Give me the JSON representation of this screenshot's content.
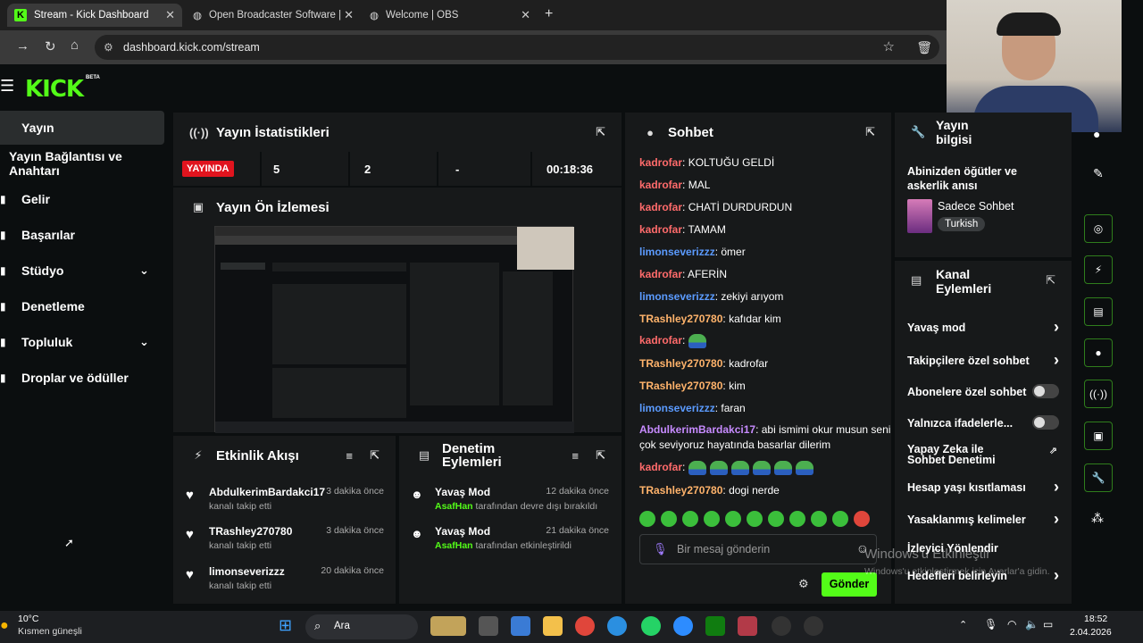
{
  "browser": {
    "tabs": [
      {
        "title": "Stream - Kick Dashboard",
        "active": true
      },
      {
        "title": "Open Broadcaster Software | OB",
        "active": false
      },
      {
        "title": "Welcome | OBS",
        "active": false
      }
    ],
    "url": "dashboard.kick.com/stream"
  },
  "logo": {
    "text": "KICK",
    "badge": "BETA"
  },
  "sidebar": {
    "items": [
      {
        "label": "Yayın",
        "active": true
      },
      {
        "label": "Yayın Bağlantısı ve Anahtarı"
      },
      {
        "label": "Gelir"
      },
      {
        "label": "Başarılar"
      },
      {
        "label": "Stüdyo",
        "expand": true
      },
      {
        "label": "Denetleme"
      },
      {
        "label": "Topluluk",
        "expand": true
      },
      {
        "label": "Droplar ve ödüller"
      }
    ]
  },
  "stats": {
    "title": "Yayın İstatistikleri",
    "live": "YAYINDA",
    "viewers": "5",
    "followers": "2",
    "subs": "-",
    "duration": "00:18:36"
  },
  "preview": {
    "title": "Yayın Ön İzlemesi"
  },
  "activity": {
    "title": "Etkinlik Akışı",
    "items": [
      {
        "user": "AbdulkerimBardakci17",
        "time": "3 dakika önce",
        "text": "kanalı takip etti"
      },
      {
        "user": "TRashley270780",
        "time": "3 dakika önce",
        "text": "kanalı takip etti"
      },
      {
        "user": "limonseverizzz",
        "time": "20 dakika önce",
        "text": "kanalı takip etti"
      }
    ]
  },
  "moderation": {
    "title": "Denetim Eylemleri",
    "items": [
      {
        "action": "Yavaş Mod",
        "time": "12 dakika önce",
        "by": "AsafHan",
        "text": "tarafından devre dışı bırakıldı"
      },
      {
        "action": "Yavaş Mod",
        "time": "21 dakika önce",
        "by": "AsafHan",
        "text": "tarafından etkinleştirildi"
      }
    ]
  },
  "chat": {
    "title": "Sohbet",
    "colors": {
      "kadrofar": "#ff6b6b",
      "limonseverizzz": "#5b9bff",
      "TRashley270780": "#ffb36b",
      "AbdulkerimBardakci17": "#c78bff"
    },
    "messages": [
      {
        "user": "kadrofar",
        "text": "KOLTUĞU GELDİ"
      },
      {
        "user": "kadrofar",
        "text": "MAL"
      },
      {
        "user": "kadrofar",
        "text": "CHATİ DURDURDUN"
      },
      {
        "user": "kadrofar",
        "text": "TAMAM"
      },
      {
        "user": "limonseverizzz",
        "text": "ömer"
      },
      {
        "user": "kadrofar",
        "text": "AFERİN"
      },
      {
        "user": "limonseverizzz",
        "text": "zekiyi arıyom"
      },
      {
        "user": "TRashley270780",
        "text": "kafıdar kim"
      },
      {
        "user": "kadrofar",
        "text": "",
        "emotes": 1
      },
      {
        "user": "TRashley270780",
        "text": "kadrofar"
      },
      {
        "user": "TRashley270780",
        "text": "kim"
      },
      {
        "user": "limonseverizzz",
        "text": "faran"
      },
      {
        "user": "AbdulkerimBardakci17",
        "text": "abi ismimi okur musun seni",
        "text2": "çok seviyoruz hayatında basarlar dilerim"
      },
      {
        "user": "kadrofar",
        "text": "",
        "emotes": 6
      },
      {
        "user": "TRashley270780",
        "text": "dogi nerde"
      }
    ],
    "placeholder": "Bir mesaj gönderin",
    "send": "Gönder"
  },
  "info": {
    "title": "Yayın bilgisi",
    "stream_title": "Abinizden öğütler ve askerlik anısı",
    "category": "Sadece Sohbet",
    "tag": "Turkish"
  },
  "channel_actions": {
    "title": "Kanal Eylemleri",
    "items": [
      {
        "label": "Yavaş mod",
        "kind": "chevron"
      },
      {
        "label": "Takipçilere özel sohbet",
        "kind": "chevron"
      },
      {
        "label": "Abonelere özel sohbet",
        "kind": "toggle"
      },
      {
        "label": "Yalnızca ifadelerle...",
        "kind": "toggle"
      },
      {
        "label": "Yapay Zeka ile Sohbet Denetimi",
        "kind": "link"
      },
      {
        "label": "Hesap yaşı kısıtlaması",
        "kind": "chevron"
      },
      {
        "label": "Yasaklanmış kelimeler",
        "kind": "chevron"
      },
      {
        "label": "İzleyici Yönlendir",
        "kind": "none"
      },
      {
        "label": "Hedefleri belirleyin",
        "kind": "chevron"
      }
    ]
  },
  "watermark": {
    "line1": "Windows'u Etkinleştir",
    "line2": "Windows'u etkinleştirmek için Ayarlar'a gidin."
  },
  "taskbar": {
    "weather_temp": "10°C",
    "weather_desc": "Kısmen güneşli",
    "search": "Ara",
    "time": "18:52",
    "date": "2.04.2026"
  }
}
